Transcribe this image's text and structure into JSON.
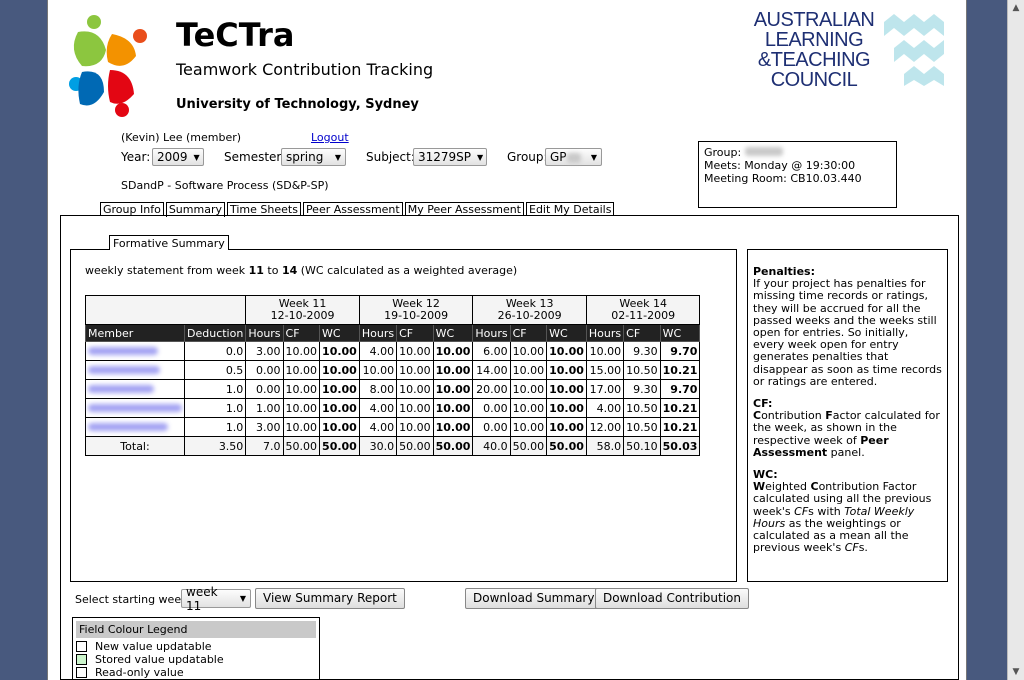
{
  "header": {
    "app_name": "TeCTra",
    "subtitle": "Teamwork Contribution Tracking",
    "university": "University of Technology, Sydney",
    "council_logo_lines": [
      "AUSTRALIAN",
      "LEARNING",
      "&TEACHING",
      "COUNCIL"
    ]
  },
  "user": {
    "name": "(Kevin) Lee (member)",
    "logout_label": "Logout"
  },
  "filters": {
    "year_label": "Year:",
    "year_value": "2009",
    "semester_label": "Semester:",
    "semester_value": "spring",
    "subject_label": "Subject:",
    "subject_value": "31279SP",
    "group_label": "Group:",
    "group_value": "GP"
  },
  "subject_name": "SDandP - Software Process (SD&P-SP)",
  "group_info": {
    "group_label": "Group:",
    "meets": "Meets: Monday @ 19:30:00",
    "room": "Meeting Room: CB10.03.440"
  },
  "tabs": [
    "Group Info",
    "Summary",
    "Time Sheets",
    "Peer Assessment",
    "My Peer Assessment",
    "Edit My Details"
  ],
  "active_tab": "Summary",
  "summary": {
    "tab_label": "Formative Summary",
    "statement_pre": "weekly statement from week ",
    "from_week": "11",
    "to_word": " to ",
    "to_week": "14",
    "statement_post": " (WC calculated as a weighted average)",
    "weeks": [
      {
        "label": "Week 11",
        "date": "12-10-2009"
      },
      {
        "label": "Week 12",
        "date": "19-10-2009"
      },
      {
        "label": "Week 13",
        "date": "26-10-2009"
      },
      {
        "label": "Week 14",
        "date": "02-11-2009"
      }
    ],
    "col_member": "Member",
    "col_deduction": "Deduction",
    "sub_cols": [
      "Hours",
      "CF",
      "WC"
    ],
    "rows": [
      {
        "deduction": "0.0",
        "cells": [
          "3.00",
          "10.00",
          "10.00",
          "4.00",
          "10.00",
          "10.00",
          "6.00",
          "10.00",
          "10.00",
          "10.00",
          "9.30",
          "9.70"
        ]
      },
      {
        "deduction": "0.5",
        "cells": [
          "0.00",
          "10.00",
          "10.00",
          "10.00",
          "10.00",
          "10.00",
          "14.00",
          "10.00",
          "10.00",
          "15.00",
          "10.50",
          "10.21"
        ]
      },
      {
        "deduction": "1.0",
        "cells": [
          "0.00",
          "10.00",
          "10.00",
          "8.00",
          "10.00",
          "10.00",
          "20.00",
          "10.00",
          "10.00",
          "17.00",
          "9.30",
          "9.70"
        ]
      },
      {
        "deduction": "1.0",
        "cells": [
          "1.00",
          "10.00",
          "10.00",
          "4.00",
          "10.00",
          "10.00",
          "0.00",
          "10.00",
          "10.00",
          "4.00",
          "10.50",
          "10.21"
        ]
      },
      {
        "deduction": "1.0",
        "cells": [
          "3.00",
          "10.00",
          "10.00",
          "4.00",
          "10.00",
          "10.00",
          "0.00",
          "10.00",
          "10.00",
          "12.00",
          "10.50",
          "10.21"
        ]
      }
    ],
    "total": {
      "label": "Total:",
      "deduction": "3.50",
      "cells": [
        "7.0",
        "50.00",
        "50.00",
        "30.0",
        "50.00",
        "50.00",
        "40.0",
        "50.00",
        "50.00",
        "58.0",
        "50.10",
        "50.03"
      ]
    }
  },
  "side_panel": {
    "penalties_title": "Penalties:",
    "penalties_text": "If your project has penalties for missing time records or ratings, they will be accrued for all the passed weeks and the weeks still open for entries. So initially, every week open for entry generates penalties that disappear as soon as time records or ratings are entered.",
    "cf_title": "CF:",
    "cf_c": "C",
    "cf_mid1": "ontribution ",
    "cf_f": "F",
    "cf_rest": "actor calculated for the week, as shown in the respective week of ",
    "cf_panel": "Peer Assessment",
    "cf_end": " panel.",
    "wc_title": "WC:",
    "wc_w": "W",
    "wc_mid1": "eighted ",
    "wc_c": "C",
    "wc_mid2": "ontribution Factor calculated using all the previous week's ",
    "wc_cfs": "CF",
    "wc_s": "s with ",
    "wc_twh": "Total Weekly Hours",
    "wc_mid3": " as the weightings or calculated as a mean all the previous week's ",
    "wc_cfs2": "CF",
    "wc_end": "s."
  },
  "controls": {
    "start_week_label": "Select starting week",
    "start_week_value": "week 11",
    "view_report": "View Summary Report",
    "download_summary": "Download Summary",
    "download_contribution": "Download Contribution"
  },
  "legend": {
    "title": "Field Colour Legend",
    "items": [
      {
        "label": "New value updatable",
        "color": "#ffffff"
      },
      {
        "label": "Stored value updatable",
        "color": "#ccf5cc"
      },
      {
        "label": "Read-only value",
        "color": "#ffffff"
      }
    ]
  }
}
